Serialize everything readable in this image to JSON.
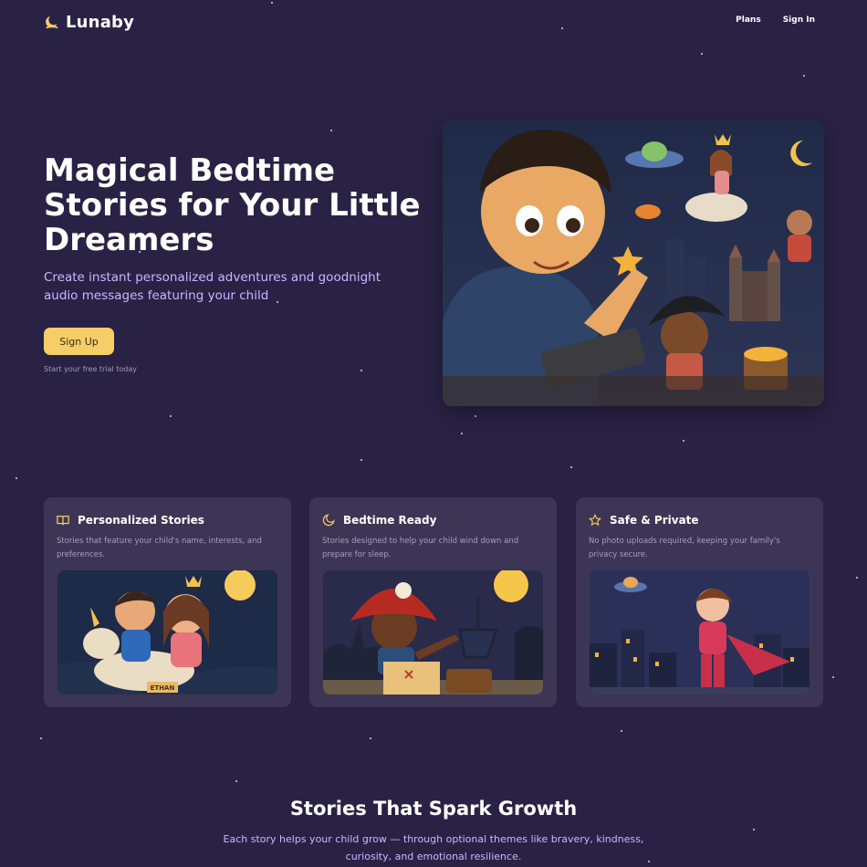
{
  "nav": {
    "brand": "Lunaby",
    "links": [
      {
        "label": "Plans"
      },
      {
        "label": "Sign In"
      }
    ]
  },
  "hero": {
    "title": "Magical Bedtime Stories for Your Little Dreamers",
    "subtitle": "Create instant personalized adventures and goodnight audio messages featuring your child",
    "cta_label": "Sign Up",
    "cta_note": "Start your free trial today"
  },
  "features": [
    {
      "icon": "book-icon",
      "title": "Personalized Stories",
      "description": "Stories that feature your child's name, interests, and preferences.",
      "image_label": "ETHAN"
    },
    {
      "icon": "moon-icon",
      "title": "Bedtime Ready",
      "description": "Stories designed to help your child wind down and prepare for sleep."
    },
    {
      "icon": "star-icon",
      "title": "Safe & Private",
      "description": "No photo uploads required, keeping your family's privacy secure."
    }
  ],
  "growth": {
    "title": "Stories That Spark Growth",
    "subtitle": "Each story helps your child grow — through optional themes like bravery, kindness, curiosity, and emotional resilience."
  },
  "colors": {
    "background": "#2a2245",
    "accent": "#f6ce68",
    "card": "#3d3555",
    "subtitle_text": "#c7b8ff"
  }
}
